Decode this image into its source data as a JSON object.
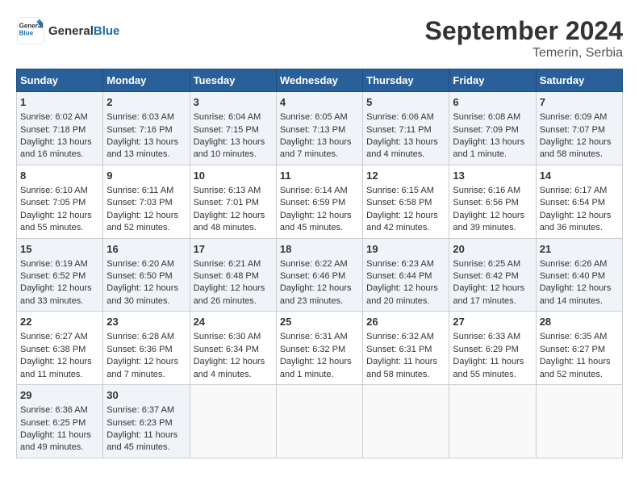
{
  "header": {
    "logo_line1": "General",
    "logo_line2": "Blue",
    "title": "September 2024",
    "subtitle": "Temerin, Serbia"
  },
  "columns": [
    "Sunday",
    "Monday",
    "Tuesday",
    "Wednesday",
    "Thursday",
    "Friday",
    "Saturday"
  ],
  "weeks": [
    [
      {
        "day": "1",
        "lines": [
          "Sunrise: 6:02 AM",
          "Sunset: 7:18 PM",
          "Daylight: 13 hours",
          "and 16 minutes."
        ]
      },
      {
        "day": "2",
        "lines": [
          "Sunrise: 6:03 AM",
          "Sunset: 7:16 PM",
          "Daylight: 13 hours",
          "and 13 minutes."
        ]
      },
      {
        "day": "3",
        "lines": [
          "Sunrise: 6:04 AM",
          "Sunset: 7:15 PM",
          "Daylight: 13 hours",
          "and 10 minutes."
        ]
      },
      {
        "day": "4",
        "lines": [
          "Sunrise: 6:05 AM",
          "Sunset: 7:13 PM",
          "Daylight: 13 hours",
          "and 7 minutes."
        ]
      },
      {
        "day": "5",
        "lines": [
          "Sunrise: 6:06 AM",
          "Sunset: 7:11 PM",
          "Daylight: 13 hours",
          "and 4 minutes."
        ]
      },
      {
        "day": "6",
        "lines": [
          "Sunrise: 6:08 AM",
          "Sunset: 7:09 PM",
          "Daylight: 13 hours",
          "and 1 minute."
        ]
      },
      {
        "day": "7",
        "lines": [
          "Sunrise: 6:09 AM",
          "Sunset: 7:07 PM",
          "Daylight: 12 hours",
          "and 58 minutes."
        ]
      }
    ],
    [
      {
        "day": "8",
        "lines": [
          "Sunrise: 6:10 AM",
          "Sunset: 7:05 PM",
          "Daylight: 12 hours",
          "and 55 minutes."
        ]
      },
      {
        "day": "9",
        "lines": [
          "Sunrise: 6:11 AM",
          "Sunset: 7:03 PM",
          "Daylight: 12 hours",
          "and 52 minutes."
        ]
      },
      {
        "day": "10",
        "lines": [
          "Sunrise: 6:13 AM",
          "Sunset: 7:01 PM",
          "Daylight: 12 hours",
          "and 48 minutes."
        ]
      },
      {
        "day": "11",
        "lines": [
          "Sunrise: 6:14 AM",
          "Sunset: 6:59 PM",
          "Daylight: 12 hours",
          "and 45 minutes."
        ]
      },
      {
        "day": "12",
        "lines": [
          "Sunrise: 6:15 AM",
          "Sunset: 6:58 PM",
          "Daylight: 12 hours",
          "and 42 minutes."
        ]
      },
      {
        "day": "13",
        "lines": [
          "Sunrise: 6:16 AM",
          "Sunset: 6:56 PM",
          "Daylight: 12 hours",
          "and 39 minutes."
        ]
      },
      {
        "day": "14",
        "lines": [
          "Sunrise: 6:17 AM",
          "Sunset: 6:54 PM",
          "Daylight: 12 hours",
          "and 36 minutes."
        ]
      }
    ],
    [
      {
        "day": "15",
        "lines": [
          "Sunrise: 6:19 AM",
          "Sunset: 6:52 PM",
          "Daylight: 12 hours",
          "and 33 minutes."
        ]
      },
      {
        "day": "16",
        "lines": [
          "Sunrise: 6:20 AM",
          "Sunset: 6:50 PM",
          "Daylight: 12 hours",
          "and 30 minutes."
        ]
      },
      {
        "day": "17",
        "lines": [
          "Sunrise: 6:21 AM",
          "Sunset: 6:48 PM",
          "Daylight: 12 hours",
          "and 26 minutes."
        ]
      },
      {
        "day": "18",
        "lines": [
          "Sunrise: 6:22 AM",
          "Sunset: 6:46 PM",
          "Daylight: 12 hours",
          "and 23 minutes."
        ]
      },
      {
        "day": "19",
        "lines": [
          "Sunrise: 6:23 AM",
          "Sunset: 6:44 PM",
          "Daylight: 12 hours",
          "and 20 minutes."
        ]
      },
      {
        "day": "20",
        "lines": [
          "Sunrise: 6:25 AM",
          "Sunset: 6:42 PM",
          "Daylight: 12 hours",
          "and 17 minutes."
        ]
      },
      {
        "day": "21",
        "lines": [
          "Sunrise: 6:26 AM",
          "Sunset: 6:40 PM",
          "Daylight: 12 hours",
          "and 14 minutes."
        ]
      }
    ],
    [
      {
        "day": "22",
        "lines": [
          "Sunrise: 6:27 AM",
          "Sunset: 6:38 PM",
          "Daylight: 12 hours",
          "and 11 minutes."
        ]
      },
      {
        "day": "23",
        "lines": [
          "Sunrise: 6:28 AM",
          "Sunset: 6:36 PM",
          "Daylight: 12 hours",
          "and 7 minutes."
        ]
      },
      {
        "day": "24",
        "lines": [
          "Sunrise: 6:30 AM",
          "Sunset: 6:34 PM",
          "Daylight: 12 hours",
          "and 4 minutes."
        ]
      },
      {
        "day": "25",
        "lines": [
          "Sunrise: 6:31 AM",
          "Sunset: 6:32 PM",
          "Daylight: 12 hours",
          "and 1 minute."
        ]
      },
      {
        "day": "26",
        "lines": [
          "Sunrise: 6:32 AM",
          "Sunset: 6:31 PM",
          "Daylight: 11 hours",
          "and 58 minutes."
        ]
      },
      {
        "day": "27",
        "lines": [
          "Sunrise: 6:33 AM",
          "Sunset: 6:29 PM",
          "Daylight: 11 hours",
          "and 55 minutes."
        ]
      },
      {
        "day": "28",
        "lines": [
          "Sunrise: 6:35 AM",
          "Sunset: 6:27 PM",
          "Daylight: 11 hours",
          "and 52 minutes."
        ]
      }
    ],
    [
      {
        "day": "29",
        "lines": [
          "Sunrise: 6:36 AM",
          "Sunset: 6:25 PM",
          "Daylight: 11 hours",
          "and 49 minutes."
        ]
      },
      {
        "day": "30",
        "lines": [
          "Sunrise: 6:37 AM",
          "Sunset: 6:23 PM",
          "Daylight: 11 hours",
          "and 45 minutes."
        ]
      },
      {
        "day": "",
        "lines": []
      },
      {
        "day": "",
        "lines": []
      },
      {
        "day": "",
        "lines": []
      },
      {
        "day": "",
        "lines": []
      },
      {
        "day": "",
        "lines": []
      }
    ]
  ]
}
